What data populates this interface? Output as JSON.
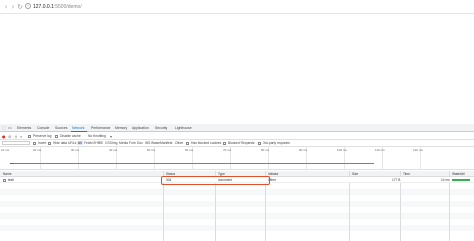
{
  "browser": {
    "url_host": "127.0.0.1",
    "url_path": ":5500/demo/",
    "icons": [
      "back-icon",
      "forward-icon",
      "reload-icon",
      "info-icon"
    ]
  },
  "devtools": {
    "tabs": [
      "Elements",
      "Console",
      "Sources",
      "Network",
      "Performance",
      "Memory",
      "Application",
      "Security",
      "Lighthouse"
    ],
    "active_tab": "Network",
    "toolbar": {
      "preserve_log": "Preserve log",
      "disable_cache": "Disable cache",
      "throttling": "No throttling"
    },
    "filter": {
      "invert": "Invert",
      "hide_data_urls": "Hide data URLs",
      "types": [
        "All",
        "Fetch/XHR",
        "JS",
        "CSS",
        "Img",
        "Media",
        "Font",
        "Doc",
        "WS",
        "Wasm",
        "Manifest",
        "Other"
      ],
      "selected_type": "All",
      "blocked_cookies": "Has blocked cookies",
      "blocked_requests": "Blocked Requests",
      "third_party": "3rd-party requests"
    },
    "overview_ticks": [
      "10 ms",
      "20 ms",
      "30 ms",
      "40 ms",
      "50 ms",
      "60 ms",
      "70 ms",
      "80 ms",
      "90 ms",
      "100 ms",
      "110 ms",
      "120 ms"
    ],
    "columns": [
      "Name",
      "Status",
      "Type",
      "Initiator",
      "Size",
      "Time",
      "Waterfall"
    ],
    "rows": [
      {
        "name": "test/",
        "status": "304",
        "type": "document",
        "initiator": "Other",
        "size": "177 B",
        "time": "14 ms"
      }
    ]
  }
}
